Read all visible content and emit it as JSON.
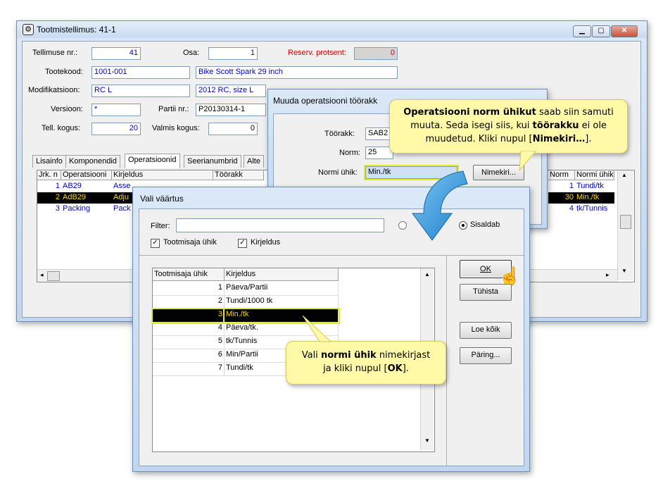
{
  "main_window": {
    "title": "Tootmistellimus: 41-1",
    "form": {
      "order_label": "Tellimuse nr.:",
      "order_value": "41",
      "part_label": "Osa:",
      "part_value": "1",
      "reserve_label": "Reserv. protsent:",
      "reserve_value": "0",
      "product_code_label": "Tootekood:",
      "product_code_value": "1001-001",
      "product_name": "Bike Scott Spark 29 inch",
      "modification_label": "Modifikatsioon:",
      "modification_value": "RC L",
      "modification_desc": "2012 RC, size L",
      "version_label": "Versioon:",
      "version_value": "*",
      "batch_label": "Partii nr.:",
      "batch_value": "P20130314-1",
      "order_qty_label": "Tell. kogus:",
      "order_qty_value": "20",
      "ready_qty_label": "Valmis kogus:",
      "ready_qty_value": "0"
    },
    "tabs": [
      "Lisainfo",
      "Komponendid",
      "Operatsioonid",
      "Seerianumbrid",
      "Alte"
    ],
    "ops_grid": {
      "headers": [
        "Jrk. n",
        "Operatsiooni",
        "Kirjeldus",
        "Töörakk"
      ],
      "right_headers": [
        "Norm",
        "Normi ühik"
      ],
      "rows": [
        {
          "n": "1",
          "op": "AB29",
          "desc": "Asse",
          "norm": "1",
          "unit": "Tundi/tk"
        },
        {
          "n": "2",
          "op": "AdB29",
          "desc": "Adju",
          "norm": "30",
          "unit": "Min./tk"
        },
        {
          "n": "3",
          "op": "Packing",
          "desc": "Pack",
          "norm": "4",
          "unit": "tk/Tunnis"
        }
      ]
    }
  },
  "change_dialog": {
    "title": "Muuda operatsiooni töörakk",
    "workcell_label": "Töörakk:",
    "workcell_value": "SAB2",
    "norm_label": "Norm:",
    "norm_value": "25",
    "unit_label": "Normi ühik:",
    "unit_value": "Min./tk",
    "list_button": "Nimekiri..."
  },
  "select_dialog": {
    "title": "Vali väärtus",
    "filter_label": "Filter:",
    "filter_value": "",
    "radio_contains": "Sisaldab",
    "chk_unit": "Tootmisaja ühik",
    "chk_desc": "Kirjeldus",
    "list_headers": [
      "Tootmisaja ühik",
      "Kirjeldus"
    ],
    "list_rows": [
      {
        "id": "1",
        "desc": "Päeva/Partii"
      },
      {
        "id": "2",
        "desc": "Tundi/1000 tk"
      },
      {
        "id": "3",
        "desc": "Min./tk"
      },
      {
        "id": "4",
        "desc": "Päeva/tk."
      },
      {
        "id": "5",
        "desc": "tk/Tunnis"
      },
      {
        "id": "6",
        "desc": "Min/Partii"
      },
      {
        "id": "7",
        "desc": "Tundi/tk"
      }
    ],
    "ok_button": "OK",
    "cancel_button": "Tühista",
    "load_all_button": "Loe kõik",
    "query_button": "Päring..."
  },
  "callout_top": {
    "b1": "Operatsiooni norm ühikut",
    "t1": " saab siin samuti muuta. Seda isegi siis, kui ",
    "b2": "töörakku",
    "t2": " ei ole muudetud. Kliki nupul [",
    "b3": "Nimekiri…",
    "t3": "]."
  },
  "callout_bottom": {
    "t1": "Vali ",
    "b1": "normi ühik",
    "t2": " nimekirjast ja kliki nupul [",
    "b2": "OK",
    "t3": "]."
  },
  "colors": {
    "accent_blue": "#0000cc",
    "selection": "#000000",
    "selection_text": "#ffd700",
    "callout_bg": "#fff9a8",
    "arrow": "#1a8fd8"
  }
}
